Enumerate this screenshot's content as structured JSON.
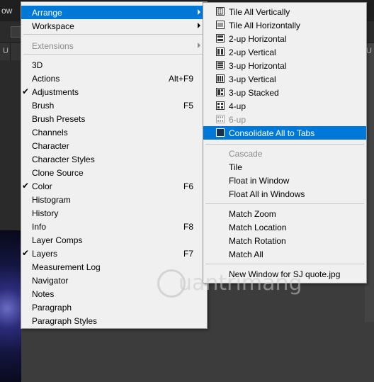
{
  "app_menubar": {
    "partial_menu_label": "ow"
  },
  "tabs": {
    "left_letter": "U",
    "right_letter": "U"
  },
  "main_menu": {
    "items": [
      {
        "label": "Arrange",
        "has_submenu": true,
        "highlighted": true
      },
      {
        "label": "Workspace",
        "has_submenu": true
      },
      {
        "label": "Extensions",
        "has_submenu": true,
        "disabled": true
      },
      {
        "label": "3D"
      },
      {
        "label": "Actions",
        "shortcut": "Alt+F9"
      },
      {
        "label": "Adjustments",
        "checked": true
      },
      {
        "label": "Brush",
        "shortcut": "F5"
      },
      {
        "label": "Brush Presets"
      },
      {
        "label": "Channels"
      },
      {
        "label": "Character"
      },
      {
        "label": "Character Styles"
      },
      {
        "label": "Clone Source"
      },
      {
        "label": "Color",
        "shortcut": "F6",
        "checked": true
      },
      {
        "label": "Histogram"
      },
      {
        "label": "History"
      },
      {
        "label": "Info",
        "shortcut": "F8"
      },
      {
        "label": "Layer Comps"
      },
      {
        "label": "Layers",
        "shortcut": "F7",
        "checked": true
      },
      {
        "label": "Measurement Log"
      },
      {
        "label": "Navigator"
      },
      {
        "label": "Notes"
      },
      {
        "label": "Paragraph"
      },
      {
        "label": "Paragraph Styles"
      }
    ]
  },
  "arrange_submenu": {
    "items": [
      {
        "label": "Tile All Vertically",
        "icon": "tile-vertical-icon"
      },
      {
        "label": "Tile All Horizontally",
        "icon": "tile-horizontal-icon"
      },
      {
        "label": "2-up Horizontal",
        "icon": "2up-horizontal-icon"
      },
      {
        "label": "2-up Vertical",
        "icon": "2up-vertical-icon"
      },
      {
        "label": "3-up Horizontal",
        "icon": "3up-horizontal-icon"
      },
      {
        "label": "3-up Vertical",
        "icon": "3up-vertical-icon"
      },
      {
        "label": "3-up Stacked",
        "icon": "3up-stacked-icon"
      },
      {
        "label": "4-up",
        "icon": "4up-icon"
      },
      {
        "label": "6-up",
        "icon": "6up-icon",
        "disabled": true
      },
      {
        "label": "Consolidate All to Tabs",
        "icon": "consolidate-tabs-icon",
        "highlighted": true
      },
      {
        "label": "Cascade",
        "disabled": true
      },
      {
        "label": "Tile"
      },
      {
        "label": "Float in Window"
      },
      {
        "label": "Float All in Windows"
      },
      {
        "label": "Match Zoom"
      },
      {
        "label": "Match Location"
      },
      {
        "label": "Match Rotation"
      },
      {
        "label": "Match All"
      },
      {
        "label": "New Window for SJ quote.jpg"
      }
    ]
  },
  "watermark": {
    "text": "uantrimang",
    "logo_icon": "quantrimang-logo-icon"
  },
  "colors": {
    "highlight": "#0078d7",
    "menu_bg": "#f0f0f0",
    "disabled_text": "#8a8a8a"
  }
}
